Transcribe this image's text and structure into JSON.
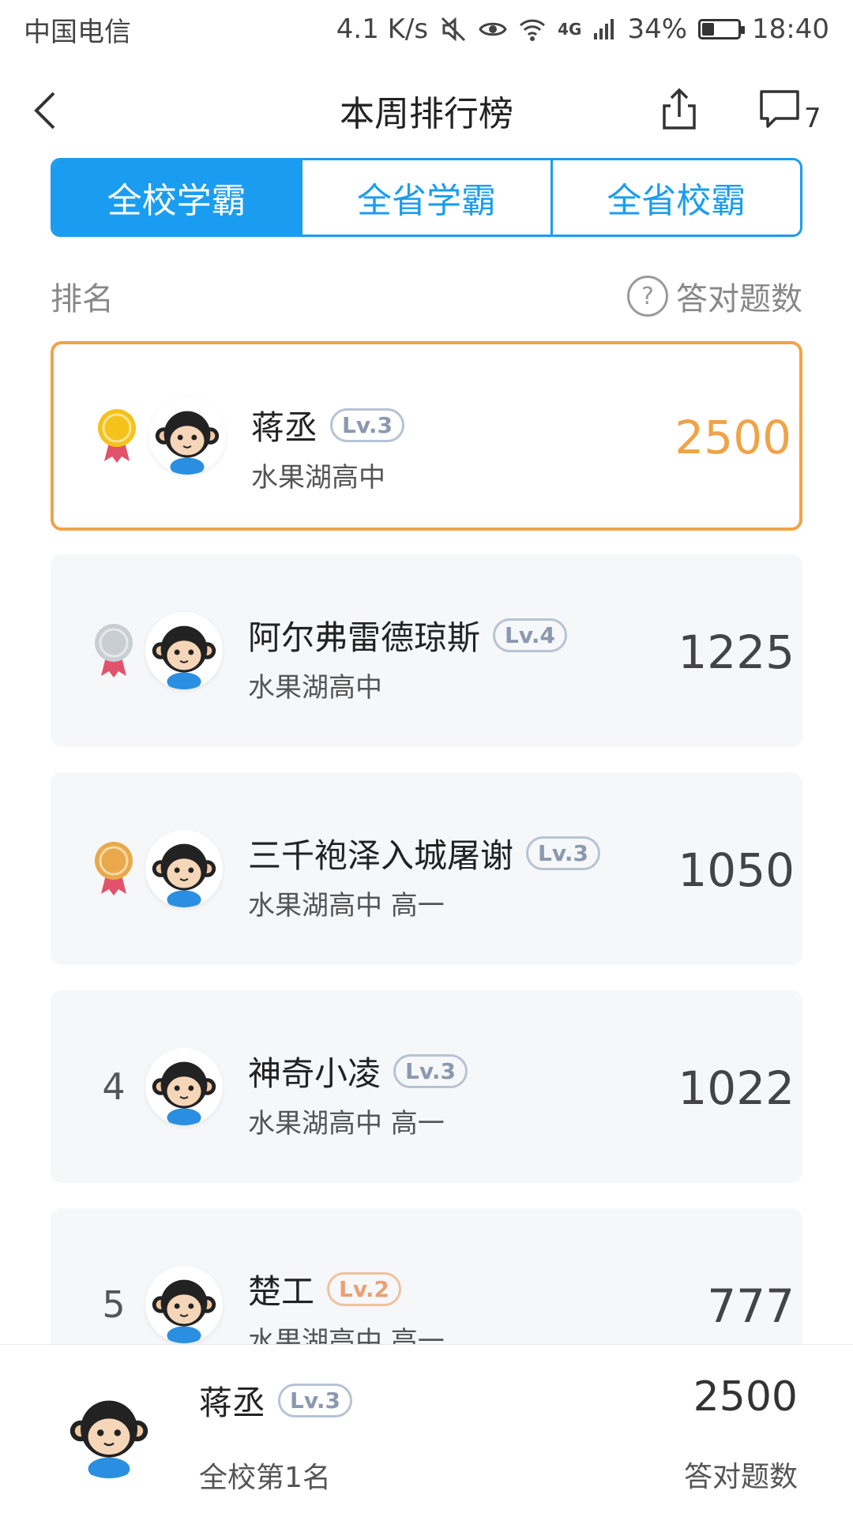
{
  "status_bar": {
    "carrier": "中国电信",
    "speed": "4.1 K/s",
    "network": "4G",
    "battery": "34%",
    "battery_level": 0.34,
    "time": "18:40"
  },
  "nav": {
    "title": "本周排行榜",
    "comment_count": "7"
  },
  "tabs": [
    {
      "label": "全校学霸",
      "active": true
    },
    {
      "label": "全省学霸",
      "active": false
    },
    {
      "label": "全省校霸",
      "active": false
    }
  ],
  "list_header": {
    "rank_label": "排名",
    "help_icon": "?",
    "score_label": "答对题数"
  },
  "entries": [
    {
      "rank": "1",
      "medal": "gold",
      "name": "蒋丞",
      "level": "Lv.3",
      "school": "水果湖高中",
      "score": "2500"
    },
    {
      "rank": "2",
      "medal": "silver",
      "name": "阿尔弗雷德琼斯",
      "level": "Lv.4",
      "school": "水果湖高中",
      "score": "1225"
    },
    {
      "rank": "3",
      "medal": "bronze",
      "name": "三千袍泽入城屠谢",
      "level": "Lv.3",
      "school": "水果湖高中 高一",
      "score": "1050"
    },
    {
      "rank": "4",
      "medal": "",
      "name": "神奇小凌",
      "level": "Lv.3",
      "school": "水果湖高中 高一",
      "score": "1022"
    },
    {
      "rank": "5",
      "medal": "",
      "name": "楚工",
      "level": "Lv.2",
      "school": "水果湖高中 高一",
      "score": "777"
    }
  ],
  "footer": {
    "name": "蒋丞",
    "level": "Lv.3",
    "rank_text": "全校第1名",
    "score": "2500",
    "score_label": "答对题数"
  },
  "colors": {
    "accent": "#1a9df0",
    "highlight": "#f0a346",
    "gold": "#f4c21a",
    "silver": "#c9ced4",
    "bronze": "#e9a94a"
  }
}
